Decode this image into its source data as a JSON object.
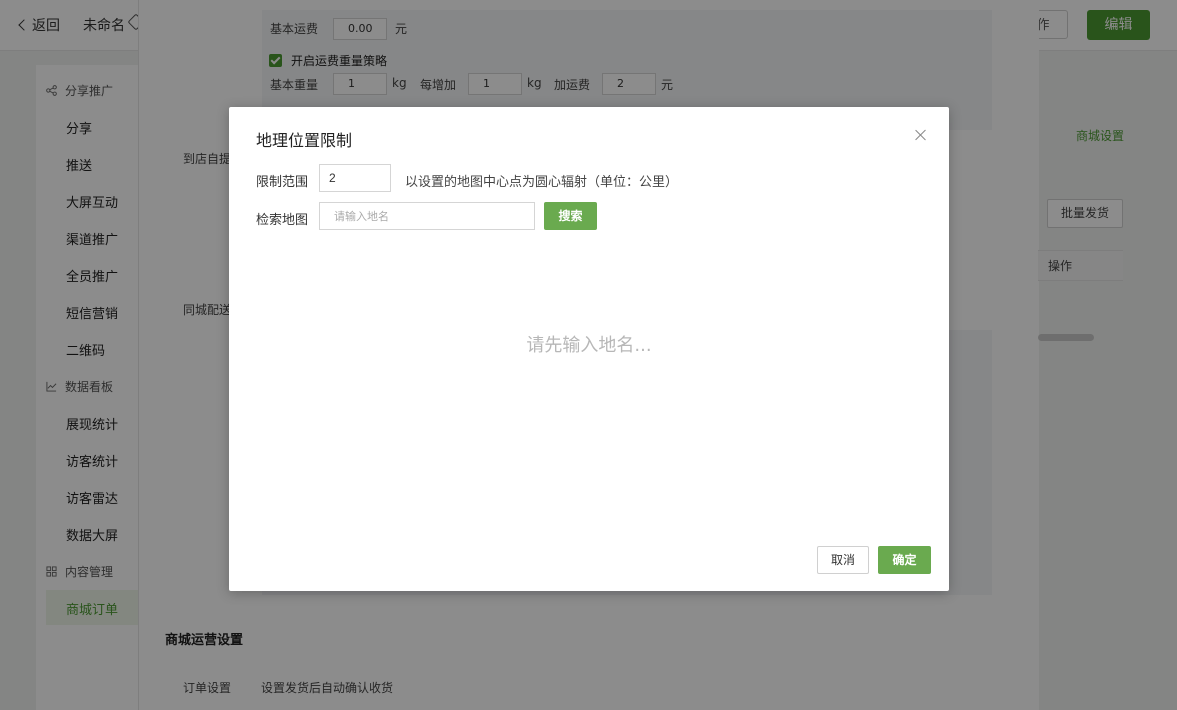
{
  "header": {
    "back_label": "返回",
    "doc_name": "未命名",
    "op_label": "作",
    "edit_label": "编辑"
  },
  "sidebar": {
    "sections": [
      {
        "label": "分享推广",
        "icon": "share-icon"
      },
      {
        "label": "数据看板",
        "icon": "chart-line-icon"
      },
      {
        "label": "内容管理",
        "icon": "grid-icon"
      }
    ],
    "items": [
      "分享",
      "推送",
      "大屏互动",
      "渠道推广",
      "全员推广",
      "短信营销",
      "二维码",
      "展现统计",
      "访客统计",
      "访客雷达",
      "数据大屏",
      "商城订单"
    ],
    "active_item": "商城订单"
  },
  "background": {
    "base_fee_label": "基本运费",
    "base_fee_value": "0.00",
    "yuan": "元",
    "weight_strategy_label": "开启运费重量策略",
    "base_weight_label": "基本重量",
    "base_weight_value": "1",
    "kg": "kg",
    "per_add_label": "每增加",
    "per_add_value": "1",
    "add_fee_label": "加运费",
    "add_fee_value": "2",
    "pickup_label": "到店自提",
    "city_delivery_label": "同城配送",
    "mall_settings_link": "商城设置",
    "batch_ship_label": "批量发货",
    "table_op_header": "操作",
    "mall_ops_title": "商城运营设置",
    "order_settings_label": "订单设置",
    "auto_confirm_text": "设置发货后自动确认收货"
  },
  "modal": {
    "title": "地理位置限制",
    "range_label": "限制范围",
    "range_value": "2",
    "range_hint": "以设置的地图中心点为圆心辐射（单位：公里）",
    "search_label": "检索地图",
    "search_placeholder": "请输入地名",
    "search_button": "搜索",
    "empty_text": "请先输入地名...",
    "cancel_button": "取消",
    "ok_button": "确定"
  },
  "colors": {
    "brand_green": "#4c9a32",
    "button_green": "#6aaa4f"
  }
}
